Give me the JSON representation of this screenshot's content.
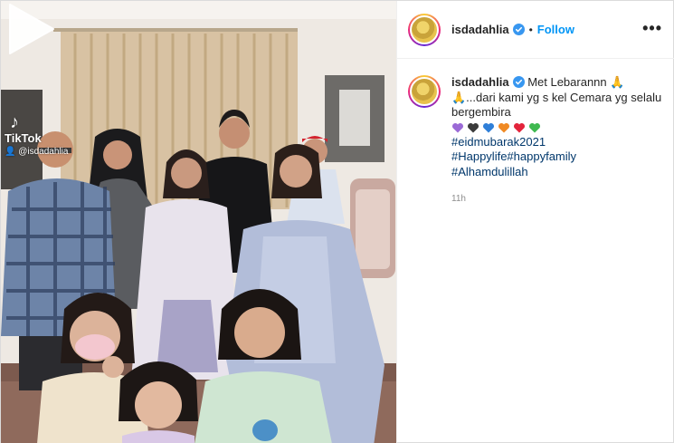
{
  "media": {
    "tiktok_logo": "TikTok",
    "tiktok_handle": "@isdadahlia",
    "play_icon": "play-icon"
  },
  "header": {
    "username": "isdadahlia",
    "separator": "•",
    "follow_label": "Follow",
    "more_label": "•••"
  },
  "caption": {
    "username": "isdadahlia",
    "line1": " Met Lebarannn 🙏",
    "line2": "🙏...dari kami yg s kel Cemara yg selalu bergembira",
    "hearts": [
      "#9b6ad6",
      "#3b3b3b",
      "#2f7fd8",
      "#f08a24",
      "#e3243b",
      "#3fb950"
    ],
    "hashtags": [
      "#eidmubarak2021",
      "#Happylife#happyfamily",
      "#Alhamdulillah"
    ],
    "time": "11h"
  },
  "colors": {
    "accent": "#0095f6",
    "hashtag": "#00376b",
    "verified": "#3897f0"
  }
}
